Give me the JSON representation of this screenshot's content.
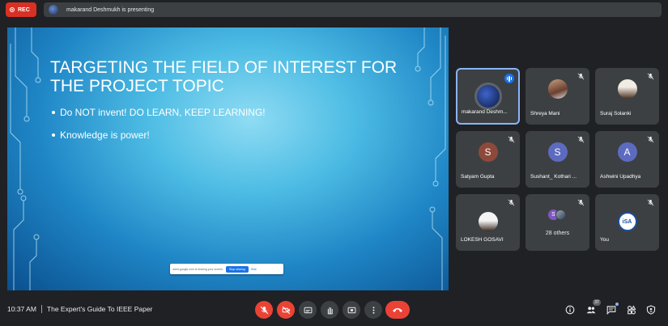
{
  "recording": {
    "label": "REC"
  },
  "presenting_bar": {
    "text": "makarand Deshmukh is presenting"
  },
  "slide": {
    "title": "TARGETING THE FIELD OF INTEREST FOR THE PROJECT TOPIC",
    "bullets": [
      "Do NOT invent! DO LEARN, KEEP LEARNING!",
      "Knowledge is power!"
    ],
    "share_notice": {
      "text": "meet.google.com is sharing your screen.",
      "stop_label": "Stop sharing",
      "hide_label": "Hide"
    }
  },
  "participants": [
    {
      "name": "makarand Deshm...",
      "type": "image",
      "speaking": true
    },
    {
      "name": "Shreya Mani",
      "type": "image",
      "muted": true
    },
    {
      "name": "Suraj Solanki",
      "type": "image",
      "muted": true
    },
    {
      "name": "Satyam Gupta",
      "initial": "S",
      "color": "#8d4a3a",
      "muted": true
    },
    {
      "name": "Sushant_ Kothari ...",
      "initial": "S",
      "color": "#5c6bc0",
      "muted": true
    },
    {
      "name": "Ashwini Upadhya",
      "initial": "A",
      "color": "#5c6bc0",
      "muted": true
    },
    {
      "name": "LOKESH GOSAVI",
      "type": "image",
      "muted": true
    },
    {
      "name": "28 others",
      "type": "others",
      "muted": true
    },
    {
      "name": "You",
      "type": "logo",
      "logo_text": "iSA",
      "muted": true
    }
  ],
  "bottom_bar": {
    "time": "10:37 AM",
    "meeting_title": "The Expert's Guide To IEEE Paper",
    "people_count": "37"
  },
  "colors": {
    "end_call": "#ea4335",
    "accent": "#8ab4f8",
    "tile_bg": "#3c4043",
    "background": "#202124"
  },
  "icons": [
    "mic-off-icon",
    "camera-off-icon",
    "captions-icon",
    "raise-hand-icon",
    "present-icon",
    "more-options-icon",
    "end-call-icon",
    "info-icon",
    "people-icon",
    "chat-icon",
    "activities-icon",
    "host-controls-icon"
  ]
}
